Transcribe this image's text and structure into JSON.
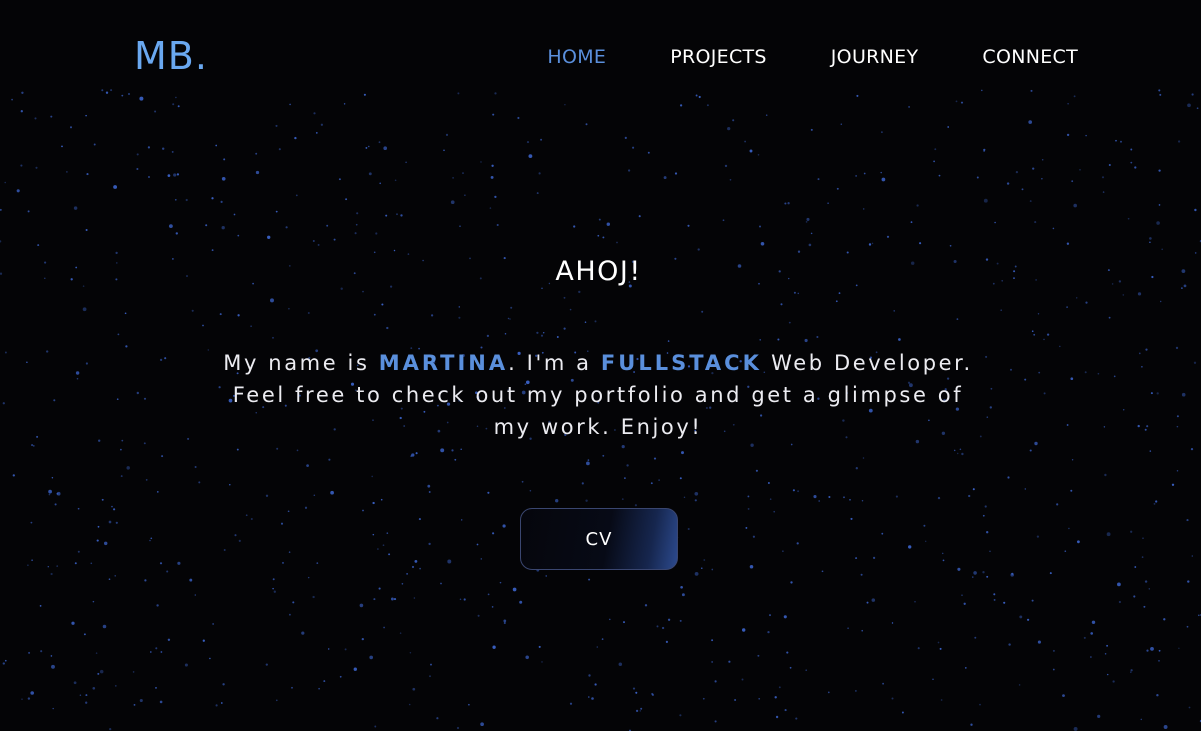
{
  "brand": {
    "logo": "MB."
  },
  "nav": {
    "items": [
      {
        "label": "HOME",
        "active": true
      },
      {
        "label": "PROJECTS",
        "active": false
      },
      {
        "label": "JOURNEY",
        "active": false
      },
      {
        "label": "CONNECT",
        "active": false
      }
    ]
  },
  "hero": {
    "greeting": "AHOJ!",
    "intro_part1": "My name is ",
    "name": "MARTINA",
    "intro_part2": ". I'm a ",
    "role": "FULLSTACK",
    "intro_part3": " Web Developer. Feel free to check out my portfolio and get a glimpse of my work. Enjoy!",
    "cv_button": "CV"
  },
  "colors": {
    "background": "#040406",
    "accent": "#5a8fdc",
    "logo": "#6aa8f0",
    "text": "#ffffff",
    "star": "#3b63c9"
  },
  "background_decoration": "star-field"
}
